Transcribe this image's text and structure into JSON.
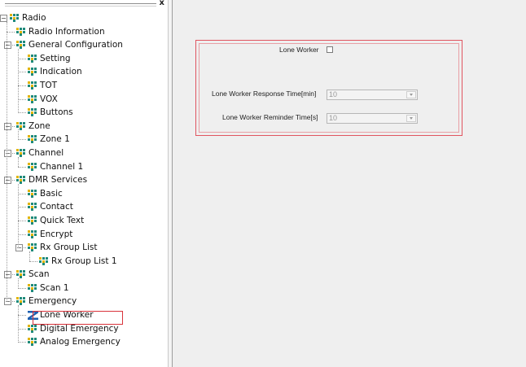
{
  "tree": {
    "close_glyph": "x",
    "nodes": [
      {
        "label": "Radio",
        "level": 0,
        "toggle": "−",
        "icon": "tree-node-icon"
      },
      {
        "label": "Radio Information",
        "level": 1,
        "toggle": "",
        "icon": "tree-node-icon"
      },
      {
        "label": "General Configuration",
        "level": 1,
        "toggle": "−",
        "icon": "tree-node-icon"
      },
      {
        "label": "Setting",
        "level": 2,
        "toggle": "",
        "icon": "tree-node-icon"
      },
      {
        "label": "Indication",
        "level": 2,
        "toggle": "",
        "icon": "tree-node-icon"
      },
      {
        "label": "TOT",
        "level": 2,
        "toggle": "",
        "icon": "tree-node-icon"
      },
      {
        "label": "VOX",
        "level": 2,
        "toggle": "",
        "icon": "tree-node-icon"
      },
      {
        "label": "Buttons",
        "level": 2,
        "toggle": "",
        "icon": "tree-node-icon"
      },
      {
        "label": "Zone",
        "level": 1,
        "toggle": "−",
        "icon": "tree-node-icon"
      },
      {
        "label": "Zone 1",
        "level": 2,
        "toggle": "",
        "icon": "tree-node-icon"
      },
      {
        "label": "Channel",
        "level": 1,
        "toggle": "−",
        "icon": "tree-node-icon"
      },
      {
        "label": "Channel 1",
        "level": 2,
        "toggle": "",
        "icon": "tree-node-icon"
      },
      {
        "label": "DMR Services",
        "level": 1,
        "toggle": "−",
        "icon": "tree-node-icon"
      },
      {
        "label": "Basic",
        "level": 2,
        "toggle": "",
        "icon": "tree-node-icon"
      },
      {
        "label": "Contact",
        "level": 2,
        "toggle": "",
        "icon": "tree-node-icon"
      },
      {
        "label": "Quick Text",
        "level": 2,
        "toggle": "",
        "icon": "tree-node-icon"
      },
      {
        "label": "Encrypt",
        "level": 2,
        "toggle": "",
        "icon": "tree-node-icon"
      },
      {
        "label": "Rx Group List",
        "level": 2,
        "toggle": "−",
        "icon": "tree-node-icon"
      },
      {
        "label": "Rx Group List 1",
        "level": 3,
        "toggle": "",
        "icon": "tree-node-icon"
      },
      {
        "label": "Scan",
        "level": 1,
        "toggle": "−",
        "icon": "tree-node-icon"
      },
      {
        "label": "Scan 1",
        "level": 2,
        "toggle": "",
        "icon": "tree-node-icon"
      },
      {
        "label": "Emergency",
        "level": 1,
        "toggle": "−",
        "icon": "tree-node-icon"
      },
      {
        "label": "Lone Worker",
        "level": 2,
        "toggle": "",
        "icon": "lone-worker-z-icon",
        "selected": true
      },
      {
        "label": "Digital Emergency",
        "level": 2,
        "toggle": "",
        "icon": "tree-node-icon"
      },
      {
        "label": "Analog Emergency",
        "level": 2,
        "toggle": "",
        "icon": "tree-node-icon"
      }
    ]
  },
  "form": {
    "lone_worker_label": "Lone Worker",
    "lone_worker_checked": false,
    "response_time_label": "Lone Worker Response Time[min]",
    "response_time_value": "10",
    "reminder_time_label": "Lone Worker Reminder Time[s]",
    "reminder_time_value": "10"
  },
  "colors": {
    "highlight_border": "#d9333b",
    "tree_icon_teal": "#1f8a7a",
    "tree_icon_yellow": "#e0b400",
    "z_icon_blue": "#1d5fb0"
  }
}
